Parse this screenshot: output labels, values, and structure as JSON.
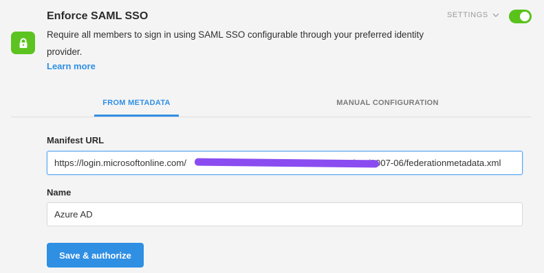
{
  "header": {
    "icon": "lock-icon",
    "title": "Enforce SAML SSO",
    "description": "Require all members to sign in using SAML SSO configurable through your preferred identity provider.",
    "learn_more": "Learn more",
    "settings_label": "SETTINGS",
    "enabled": true
  },
  "tabs": [
    {
      "label": "FROM METADATA",
      "active": true
    },
    {
      "label": "MANUAL CONFIGURATION",
      "active": false
    }
  ],
  "form": {
    "manifest_url_label": "Manifest URL",
    "manifest_url_value": "https://login.microsoftonline.com/                                        /federationmetadata/2007-06/federationmetadata.xml",
    "name_label": "Name",
    "name_value": "Azure AD",
    "submit_label": "Save & authorize"
  },
  "colors": {
    "accent": "#2f8fe3",
    "toggle_on": "#59c21b",
    "icon_tile": "#5cc320",
    "redaction": "#8a4cf0"
  }
}
